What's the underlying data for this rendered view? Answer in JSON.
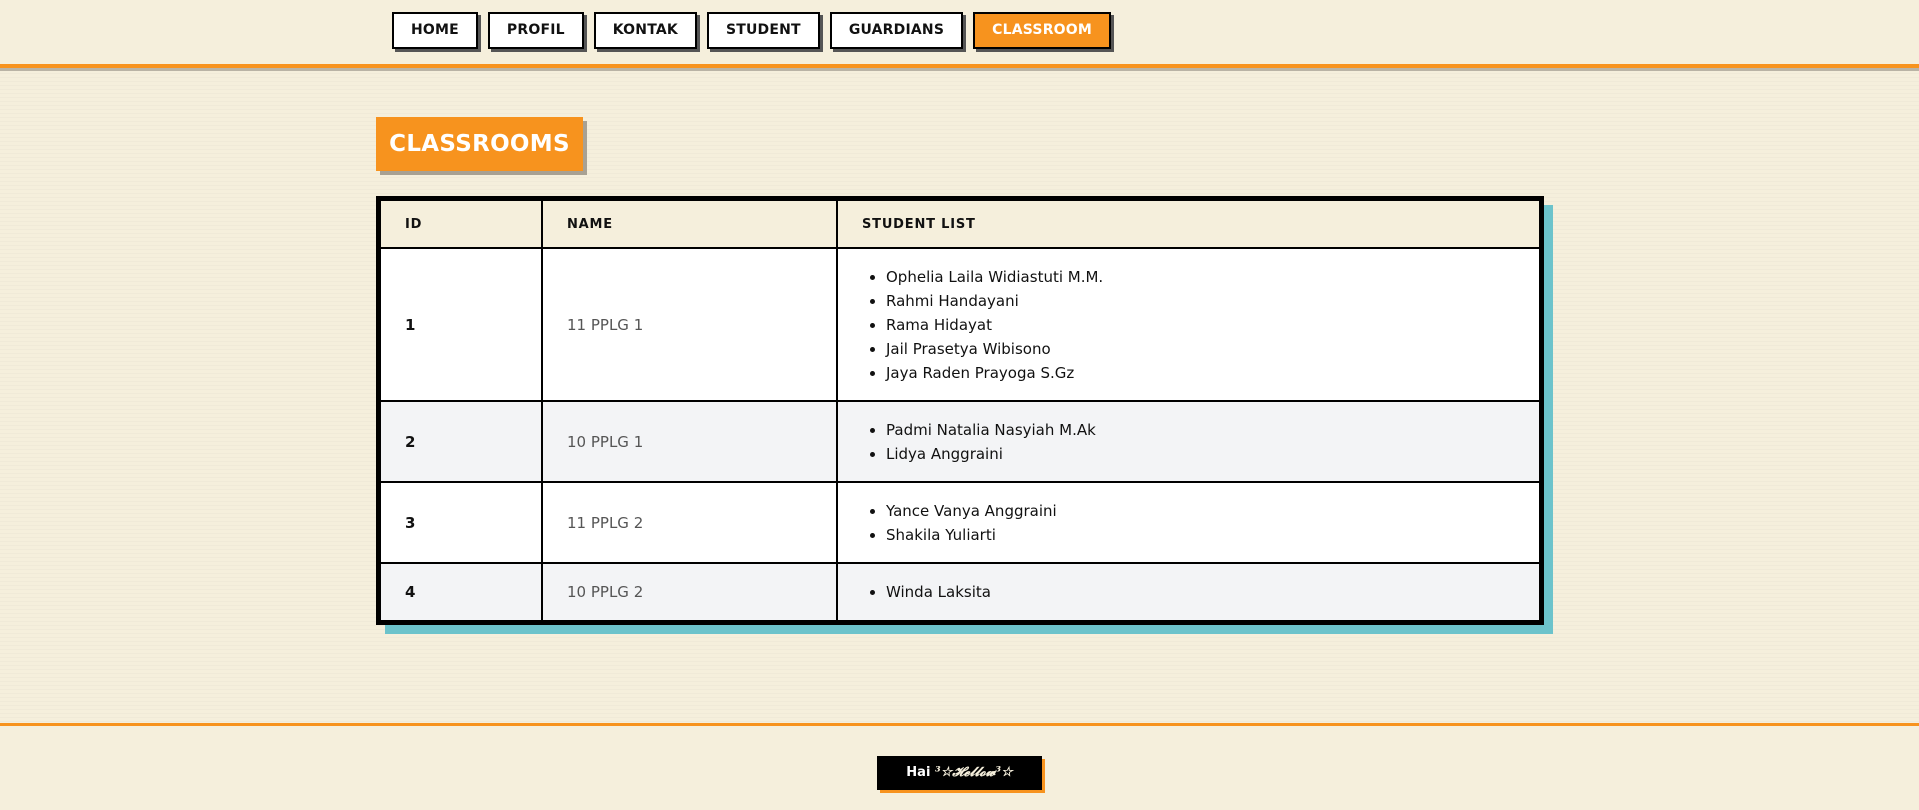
{
  "nav": {
    "items": [
      {
        "label": "HOME",
        "active": false
      },
      {
        "label": "PROFIL",
        "active": false
      },
      {
        "label": "KONTAK",
        "active": false
      },
      {
        "label": "STUDENT",
        "active": false
      },
      {
        "label": "GUARDIANS",
        "active": false
      },
      {
        "label": "CLASSROOM",
        "active": true
      }
    ]
  },
  "page": {
    "title": "CLASSROOMS"
  },
  "table": {
    "headers": {
      "id": "ID",
      "name": "NAME",
      "students": "STUDENT LIST"
    },
    "rows": [
      {
        "id": "1",
        "name": "11 PPLG 1",
        "students": [
          "Ophelia Laila Widiastuti M.M.",
          "Rahmi Handayani",
          "Rama Hidayat",
          "Jail Prasetya Wibisono",
          "Jaya Raden Prayoga S.Gz"
        ]
      },
      {
        "id": "2",
        "name": "10 PPLG 1",
        "students": [
          "Padmi Natalia Nasyiah M.Ak",
          "Lidya Anggraini"
        ]
      },
      {
        "id": "3",
        "name": "11 PPLG 2",
        "students": [
          "Yance Vanya Anggraini",
          "Shakila Yuliarti"
        ]
      },
      {
        "id": "4",
        "name": "10 PPLG 2",
        "students": [
          "Winda Laksita"
        ]
      }
    ]
  },
  "footer": {
    "greeting": "Hai",
    "fancy": "³☆𝓗𝓮𝓵𝓵𝓸𝔀³☆"
  },
  "colors": {
    "accent": "#f7931e",
    "background": "#f5efdc",
    "table_shadow": "#6cc3cb",
    "border": "#000000"
  }
}
